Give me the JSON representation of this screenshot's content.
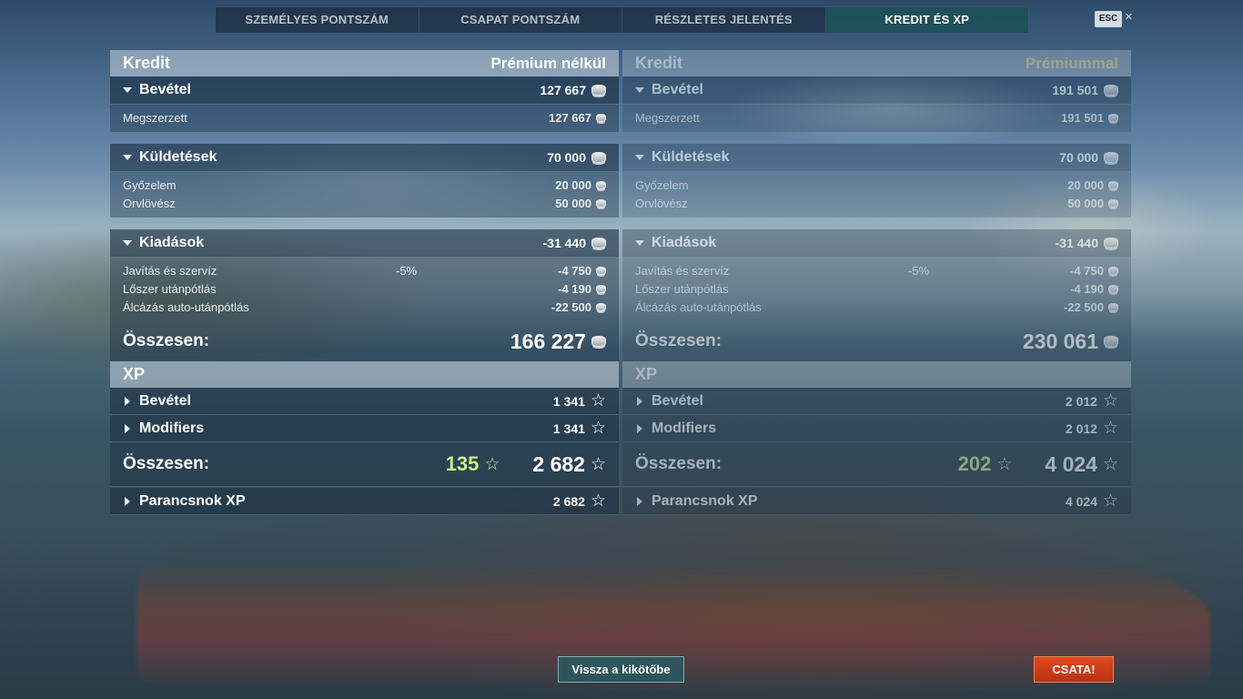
{
  "tabs": [
    {
      "label": "SZEMÉLYES PONTSZÁM"
    },
    {
      "label": "CSAPAT PONTSZÁM"
    },
    {
      "label": "RÉSZLETES JELENTÉS"
    },
    {
      "label": "KREDIT ÉS XP"
    }
  ],
  "esc_label": "ESC",
  "close_glyph": "×",
  "left": {
    "credit_title": "Kredit",
    "mode": "Prémium nélkül",
    "income": {
      "label": "Bevétel",
      "value": "127 667",
      "rows": [
        {
          "name": "Megszerzett",
          "value": "127 667"
        }
      ]
    },
    "missions": {
      "label": "Küldetések",
      "value": "70 000",
      "rows": [
        {
          "name": "Győzelem",
          "value": "20 000"
        },
        {
          "name": "Orvlövész",
          "value": "50 000"
        }
      ]
    },
    "expenses": {
      "label": "Kiadások",
      "value": "-31 440",
      "rows": [
        {
          "name": "Javítás és szervíz",
          "mid": "-5%",
          "value": "-4 750"
        },
        {
          "name": "Lőszer utánpótlás",
          "mid": "",
          "value": "-4 190"
        },
        {
          "name": "Álcázás auto-utánpótlás",
          "mid": "",
          "value": "-22 500"
        }
      ]
    },
    "total_label": "Összesen:",
    "total_value": "166 227",
    "xp_title": "XP",
    "xp_income": {
      "label": "Bevétel",
      "value": "1 341"
    },
    "xp_modifiers": {
      "label": "Modifiers",
      "value": "1 341"
    },
    "xp_total_label": "Összesen:",
    "xp_bonus": "135",
    "xp_total": "2 682",
    "commander": {
      "label": "Parancsnok XP",
      "value": "2 682"
    }
  },
  "right": {
    "credit_title": "Kredit",
    "mode": "Prémiummal",
    "income": {
      "label": "Bevétel",
      "value": "191 501",
      "rows": [
        {
          "name": "Megszerzett",
          "value": "191 501"
        }
      ]
    },
    "missions": {
      "label": "Küldetések",
      "value": "70 000",
      "rows": [
        {
          "name": "Győzelem",
          "value": "20 000"
        },
        {
          "name": "Orvlövész",
          "value": "50 000"
        }
      ]
    },
    "expenses": {
      "label": "Kiadások",
      "value": "-31 440",
      "rows": [
        {
          "name": "Javítás és szervíz",
          "mid": "-5%",
          "value": "-4 750"
        },
        {
          "name": "Lőszer utánpótlás",
          "mid": "",
          "value": "-4 190"
        },
        {
          "name": "Álcázás auto-utánpótlás",
          "mid": "",
          "value": "-22 500"
        }
      ]
    },
    "total_label": "Összesen:",
    "total_value": "230 061",
    "xp_title": "XP",
    "xp_income": {
      "label": "Bevétel",
      "value": "2 012"
    },
    "xp_modifiers": {
      "label": "Modifiers",
      "value": "2 012"
    },
    "xp_total_label": "Összesen:",
    "xp_bonus": "202",
    "xp_total": "4 024",
    "commander": {
      "label": "Parancsnok XP",
      "value": "4 024"
    }
  },
  "buttons": {
    "port": "Vissza a kikötőbe",
    "battle": "CSATA!"
  },
  "colors": {
    "active_tab": "#1e5a5f",
    "bonus_xp": "#c8f08a",
    "premium_label": "#f0d890",
    "battle": "#d03c14"
  }
}
